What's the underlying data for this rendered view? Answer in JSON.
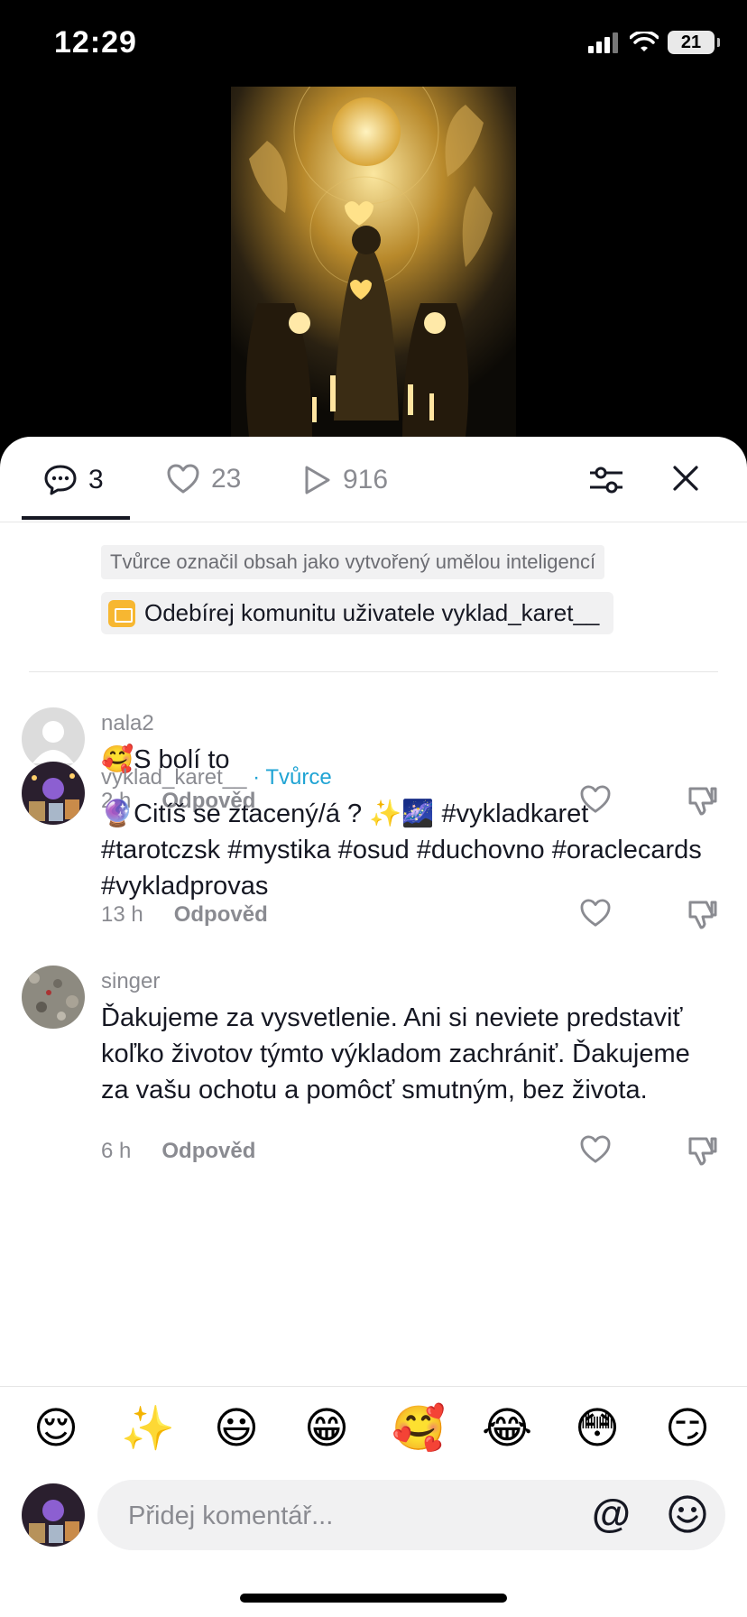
{
  "status_bar": {
    "time": "12:29",
    "battery": "21"
  },
  "tabs": {
    "comments_count": "3",
    "likes_count": "23",
    "views_count": "916"
  },
  "caption": {
    "ai_label": "Tvůrce označil obsah jako vytvořený umělou inteligencí",
    "community_label": "Odebírej komunitu uživatele vyklad_karet__"
  },
  "comments": [
    {
      "user": "nala2",
      "creator_badge": "",
      "emoji": "🥰",
      "text": "S bolí to",
      "time": "2 h",
      "reply": "Odpověd"
    },
    {
      "user": "vyklad_karet__",
      "creator_badge": " · Tvůrce",
      "emoji": "🔮",
      "text": "Citíš se ztacený/á ? ✨🌌 #vykladkaret #tarotczsk #mystika #osud #duchovno #oracle­cards #vykladprovas",
      "time": "13 h",
      "reply": "Odpověd"
    },
    {
      "user": "singer",
      "creator_badge": "",
      "emoji": "",
      "text": "Ďakujeme za vysvetlenie. Ani si neviete predstaviť koľko životov týmto výkladom zachrániť. Ďakujeme za vašu ochotu a pomôcť smutným, bez života.",
      "time": "6 h",
      "reply": "Odpověd"
    }
  ],
  "emoji_bar": [
    "😌",
    "✨",
    "😃",
    "😁",
    "🥰",
    "😂",
    "😳",
    "😏"
  ],
  "input": {
    "placeholder": "Přidej komentář...",
    "at_symbol": "@"
  },
  "colors": {
    "creator_accent": "#20a4d4",
    "folder": "#f7b731"
  }
}
